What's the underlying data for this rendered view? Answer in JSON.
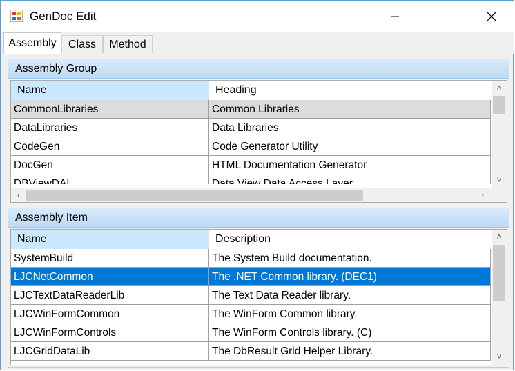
{
  "window": {
    "title": "GenDoc Edit"
  },
  "tabs": [
    {
      "label": "Assembly"
    },
    {
      "label": "Class"
    },
    {
      "label": "Method"
    }
  ],
  "assembly_group": {
    "header": "Assembly Group",
    "columns": [
      "Name",
      "Heading"
    ],
    "rows": [
      {
        "name": "CommonLibraries",
        "value": "Common Libraries"
      },
      {
        "name": "DataLibraries",
        "value": "Data Libraries"
      },
      {
        "name": "CodeGen",
        "value": "Code Generator Utility"
      },
      {
        "name": "DocGen",
        "value": "HTML Documentation Generator"
      },
      {
        "name": "DBViewDAL",
        "value": "Data View Data Access Layer"
      }
    ]
  },
  "assembly_item": {
    "header": "Assembly Item",
    "columns": [
      "Name",
      "Description"
    ],
    "rows": [
      {
        "name": "SystemBuild",
        "value": "The System Build documentation."
      },
      {
        "name": "LJCNetCommon",
        "value": "The .NET Common library. (DEC1)"
      },
      {
        "name": "LJCTextDataReaderLib",
        "value": "The Text Data Reader library."
      },
      {
        "name": "LJCWinFormCommon",
        "value": "The WinForm Common library."
      },
      {
        "name": "LJCWinFormControls",
        "value": "The WinForm Controls library. (C)"
      },
      {
        "name": "LJCGridDataLib",
        "value": "The DbResult Grid Helper Library."
      }
    ]
  },
  "colors": {
    "selection": "#0078d7",
    "header_gradient": "#bcdaf4"
  },
  "icons": [
    "app-icon",
    "minimize-icon",
    "maximize-icon",
    "close-icon",
    "scroll-up-icon",
    "scroll-down-icon",
    "scroll-left-icon",
    "scroll-right-icon"
  ]
}
